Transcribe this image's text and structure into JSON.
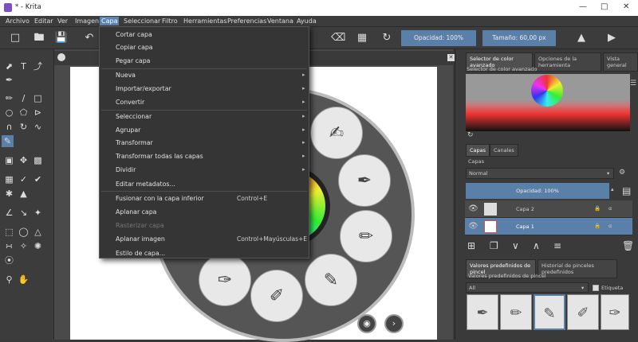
{
  "window": {
    "title": "* - Krita",
    "icon": "krita-logo-icon"
  },
  "menubar": {
    "items": [
      "Archivo",
      "Editar",
      "Ver",
      "Imagen",
      "Capa",
      "Seleccionar",
      "Filtro",
      "Herramientas",
      "Preferencias",
      "Ventana",
      "Ayuda"
    ],
    "active": "Capa"
  },
  "toolbar": {
    "opacity_label": "Opacidad: 100%",
    "size_label": "Tamaño: 60,00 px"
  },
  "context_menu": {
    "items": [
      {
        "label": "Cortar capa"
      },
      {
        "label": "Copiar capa"
      },
      {
        "label": "Pegar capa"
      },
      {
        "label": "Nueva",
        "submenu": true
      },
      {
        "label": "Importar/exportar",
        "submenu": true
      },
      {
        "label": "Convertir",
        "submenu": true
      },
      {
        "label": "Seleccionar",
        "submenu": true
      },
      {
        "label": "Agrupar",
        "submenu": true
      },
      {
        "label": "Transformar",
        "submenu": true
      },
      {
        "label": "Transformar todas las capas",
        "submenu": true
      },
      {
        "label": "Dividir",
        "submenu": true
      },
      {
        "label": "Editar metadatos..."
      },
      {
        "label": "Fusionar con la capa inferior",
        "shortcut": "Control+E"
      },
      {
        "label": "Aplanar capa"
      },
      {
        "label": "Rasterizar capa",
        "disabled": true
      },
      {
        "label": "Aplanar imagen",
        "shortcut": "Control+Mayúsculas+E"
      },
      {
        "label": "Estilo de capa..."
      }
    ]
  },
  "dock": {
    "top_tabs": [
      "Selector de color avanzado",
      "Opciones de la herramienta",
      "Vista general"
    ],
    "color_selector_label": "Selector de color avanzado",
    "layer_tabs": [
      "Capas",
      "Canales"
    ],
    "layers_header": "Capas",
    "blend_mode": "Normal",
    "layer_opacity": "Opacidad: 100%",
    "layers": [
      {
        "name": "Capa 2",
        "selected": false
      },
      {
        "name": "Capa 1",
        "selected": true
      }
    ],
    "bottom_tabs": [
      "Valores predefinidos de pincel",
      "Historial de pinceles predefinidos"
    ],
    "presets_header": "Valores predefinidos de pincel",
    "preset_filter": "All",
    "tag_label": "Etiqueta"
  }
}
